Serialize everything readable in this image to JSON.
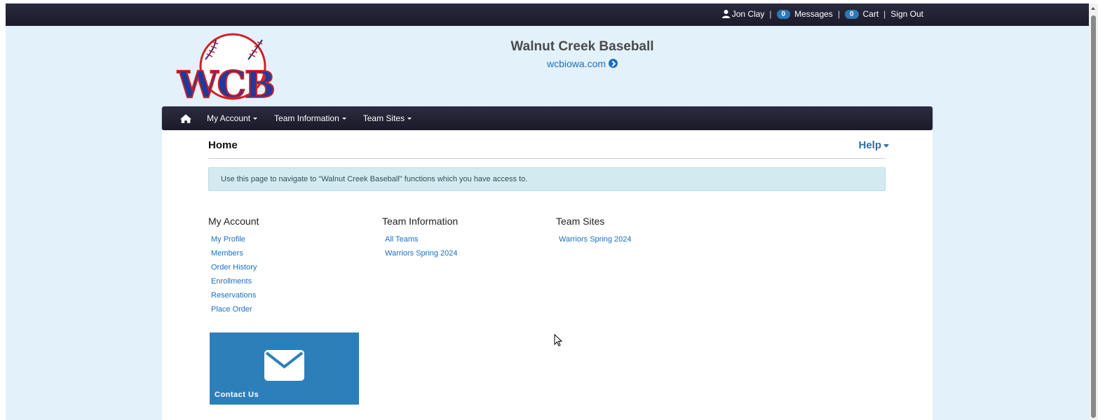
{
  "topbar": {
    "user_name": "Jon Clay",
    "messages_count": "0",
    "messages_label": "Messages",
    "cart_count": "0",
    "cart_label": "Cart",
    "sign_out_label": "Sign Out",
    "separator": "|"
  },
  "header": {
    "logo_text": "WCB",
    "site_title": "Walnut Creek Baseball",
    "site_url": "wcbiowa.com"
  },
  "navbar": {
    "items": [
      {
        "label": "My Account"
      },
      {
        "label": "Team Information"
      },
      {
        "label": "Team Sites"
      }
    ]
  },
  "page": {
    "title": "Home",
    "help_label": "Help",
    "info_text": "Use this page to navigate to \"Walnut Creek Baseball\" functions which you have access to."
  },
  "sections": {
    "my_account": {
      "heading": "My Account",
      "links": [
        "My Profile",
        "Members",
        "Order History",
        "Enrollments",
        "Reservations",
        "Place Order"
      ]
    },
    "team_information": {
      "heading": "Team Information",
      "links": [
        "All Teams",
        "Warriors Spring 2024"
      ]
    },
    "team_sites": {
      "heading": "Team Sites",
      "links": [
        "Warriors Spring 2024"
      ]
    }
  },
  "contact_tile": {
    "label": "Contact Us",
    "icon": "envelope-icon"
  },
  "colors": {
    "topbar_bg": "#1c1b2c",
    "page_bg": "#e3f1fb",
    "link": "#1a6fc2",
    "badge": "#2e79b5",
    "tile_bg": "#2d7fba",
    "info_bg": "#d3ebf0"
  }
}
